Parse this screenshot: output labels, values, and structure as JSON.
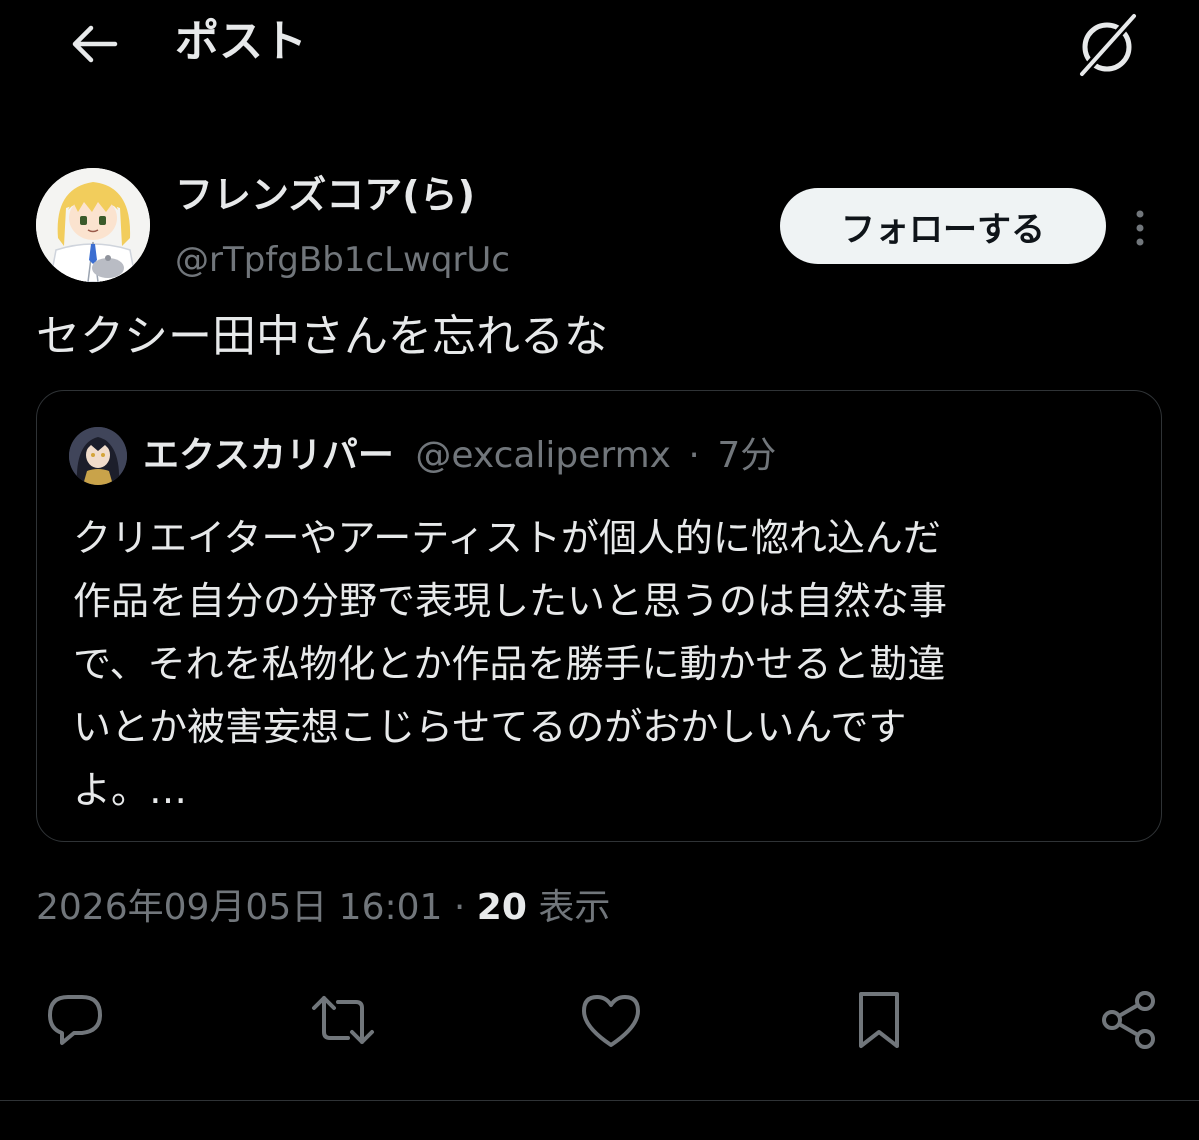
{
  "header": {
    "title": "ポスト",
    "back_icon": "arrow-left-icon",
    "grok_icon": "grok-icon"
  },
  "post": {
    "author": {
      "display_name": "フレンズコア(ら)",
      "handle": "@rTpfgBb1cLwqrUc"
    },
    "follow_label": "フォローする",
    "text": "セクシー田中さんを忘れるな",
    "timestamp": "2026年09月05日 16:01",
    "separator": "·",
    "views_count": "20",
    "views_label": "表示"
  },
  "quote": {
    "display_name": "エクスカリパー",
    "handle": "@excalipermx",
    "meta_separator": "·",
    "time": "7分",
    "lines": [
      "クリエイターやアーティストが個人的に惚れ込んだ",
      "作品を自分の分野で表現したいと思うのは自然な事",
      "で、それを私物化とか作品を勝手に動かせると勘違",
      "いとか被害妄想こじらせてるのがおかしいんです",
      "よ。…"
    ]
  },
  "actions": [
    {
      "icon": "reply-icon"
    },
    {
      "icon": "repost-icon"
    },
    {
      "icon": "like-icon"
    },
    {
      "icon": "bookmark-icon"
    },
    {
      "icon": "share-icon"
    }
  ],
  "colors": {
    "background": "#000000",
    "text_primary": "#e7e9ea",
    "text_secondary": "#71767b",
    "border": "#2f3336",
    "follow_bg": "#eff3f4"
  }
}
